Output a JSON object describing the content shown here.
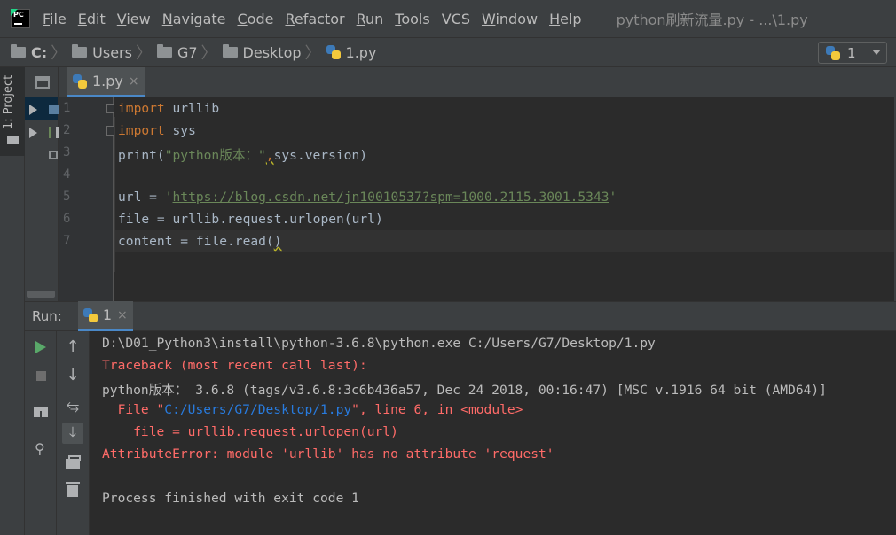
{
  "menu": {
    "items": [
      {
        "underline": "F",
        "rest": "ile"
      },
      {
        "underline": "E",
        "rest": "dit"
      },
      {
        "underline": "V",
        "rest": "iew"
      },
      {
        "underline": "N",
        "rest": "avigate"
      },
      {
        "underline": "C",
        "rest": "ode"
      },
      {
        "underline": "R",
        "rest": "efactor"
      },
      {
        "underline": "R",
        "rest": "un"
      },
      {
        "underline": "T",
        "rest": "ools"
      },
      {
        "underline": "",
        "rest": "VCS"
      },
      {
        "underline": "W",
        "rest": "indow"
      },
      {
        "underline": "H",
        "rest": "elp"
      }
    ],
    "window_title": "python刷新流量.py - ...\\1.py"
  },
  "breadcrumb": {
    "drive": "C:",
    "users": "Users",
    "user": "G7",
    "desktop": "Desktop",
    "file": "1.py"
  },
  "run_config": {
    "label": "1"
  },
  "project_tab": {
    "label": "1: Project"
  },
  "editor": {
    "tab_label": "1.py",
    "tab_close": "×",
    "line_numbers": [
      "1",
      "2",
      "3",
      "4",
      "5",
      "6",
      "7"
    ],
    "lines": {
      "l1_kw": "import",
      "l1_rest": " urllib",
      "l2_kw": "import",
      "l2_rest": " sys",
      "l3_a": "print(",
      "l3_str": "\"python版本：\"",
      "l3_comma": ",",
      "l3_rest": "sys.version)",
      "l5_a": "url = ",
      "l5_q1": "'",
      "l5_url": "https://blog.csdn.net/jn10010537?spm=1000.2115.3001.5343",
      "l5_q2": "'",
      "l6": "file = urllib.request.urlopen(url)",
      "l7_a": "content = file.read(",
      "l7_b": ")"
    }
  },
  "run": {
    "label": "Run:",
    "tab_label": "1",
    "tab_close": "×",
    "console": {
      "l1": "D:\\D01_Python3\\install\\python-3.6.8\\python.exe C:/Users/G7/Desktop/1.py",
      "l2": "Traceback (most recent call last):",
      "l3": "python版本： 3.6.8 (tags/v3.6.8:3c6b436a57, Dec 24 2018, 00:16:47) [MSC v.1916 64 bit (AMD64)]",
      "l4_a": "  File \"",
      "l4_link": "C:/Users/G7/Desktop/1.py",
      "l4_b": "\", line 6, in <module>",
      "l5": "    file = urllib.request.urlopen(url)",
      "l6": "AttributeError: module 'urllib' has no attribute 'request'",
      "l7": "Process finished with exit code 1"
    }
  },
  "icons": {
    "play": "play-icon",
    "stop": "stop-icon",
    "up": "↑",
    "down": "↓",
    "wrap": "⥃",
    "scroll_end": "⤓",
    "pin": "📌"
  },
  "colors": {
    "background": "#2b2b2b",
    "keyword": "#cc7832",
    "string": "#6a8759",
    "error": "#ff6b68",
    "link": "#287bde",
    "accent": "#4a88c7"
  }
}
